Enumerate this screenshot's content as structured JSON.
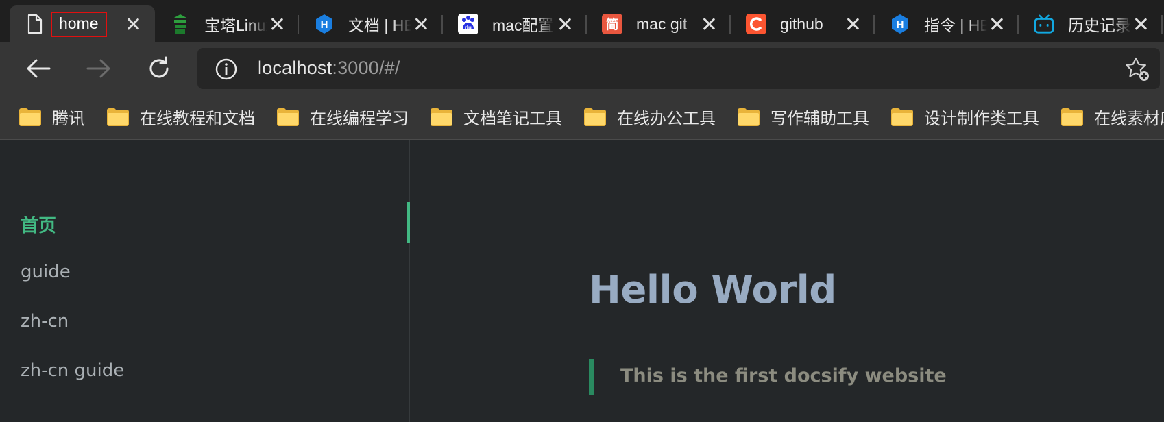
{
  "browser": {
    "tabs": [
      {
        "title": "home",
        "icon": "document-icon",
        "active": true,
        "highlighted": true
      },
      {
        "title": "宝塔Linux面板",
        "icon": "baota-icon",
        "active": false
      },
      {
        "title": "文档 | HBuilderX",
        "icon": "hbuilder-icon",
        "active": false
      },
      {
        "title": "mac配置",
        "icon": "baidu-icon",
        "active": false
      },
      {
        "title": "mac git",
        "icon": "jianshu-icon",
        "active": false
      },
      {
        "title": "github",
        "icon": "csdn-icon",
        "active": false
      },
      {
        "title": "指令 | HBuilderX",
        "icon": "hbuilder-icon",
        "active": false
      },
      {
        "title": "历史记录",
        "icon": "bilibili-icon",
        "active": false
      }
    ],
    "address": {
      "host": "localhost",
      "path": ":3000/#/"
    },
    "bookmarks": [
      "腾讯",
      "在线教程和文档",
      "在线编程学习",
      "文档笔记工具",
      "在线办公工具",
      "写作辅助工具",
      "设计制作类工具",
      "在线素材库"
    ]
  },
  "sidebar": {
    "items": [
      {
        "label": "首页",
        "active": true
      },
      {
        "label": "guide",
        "active": false
      },
      {
        "label": "zh-cn",
        "active": false
      },
      {
        "label": "zh-cn guide",
        "active": false
      }
    ]
  },
  "content": {
    "heading": "Hello World",
    "blockquote": "This is the first docsify website"
  },
  "colors": {
    "accent": "#42b983",
    "heading": "#98abc2",
    "highlight_border": "#e01010"
  }
}
